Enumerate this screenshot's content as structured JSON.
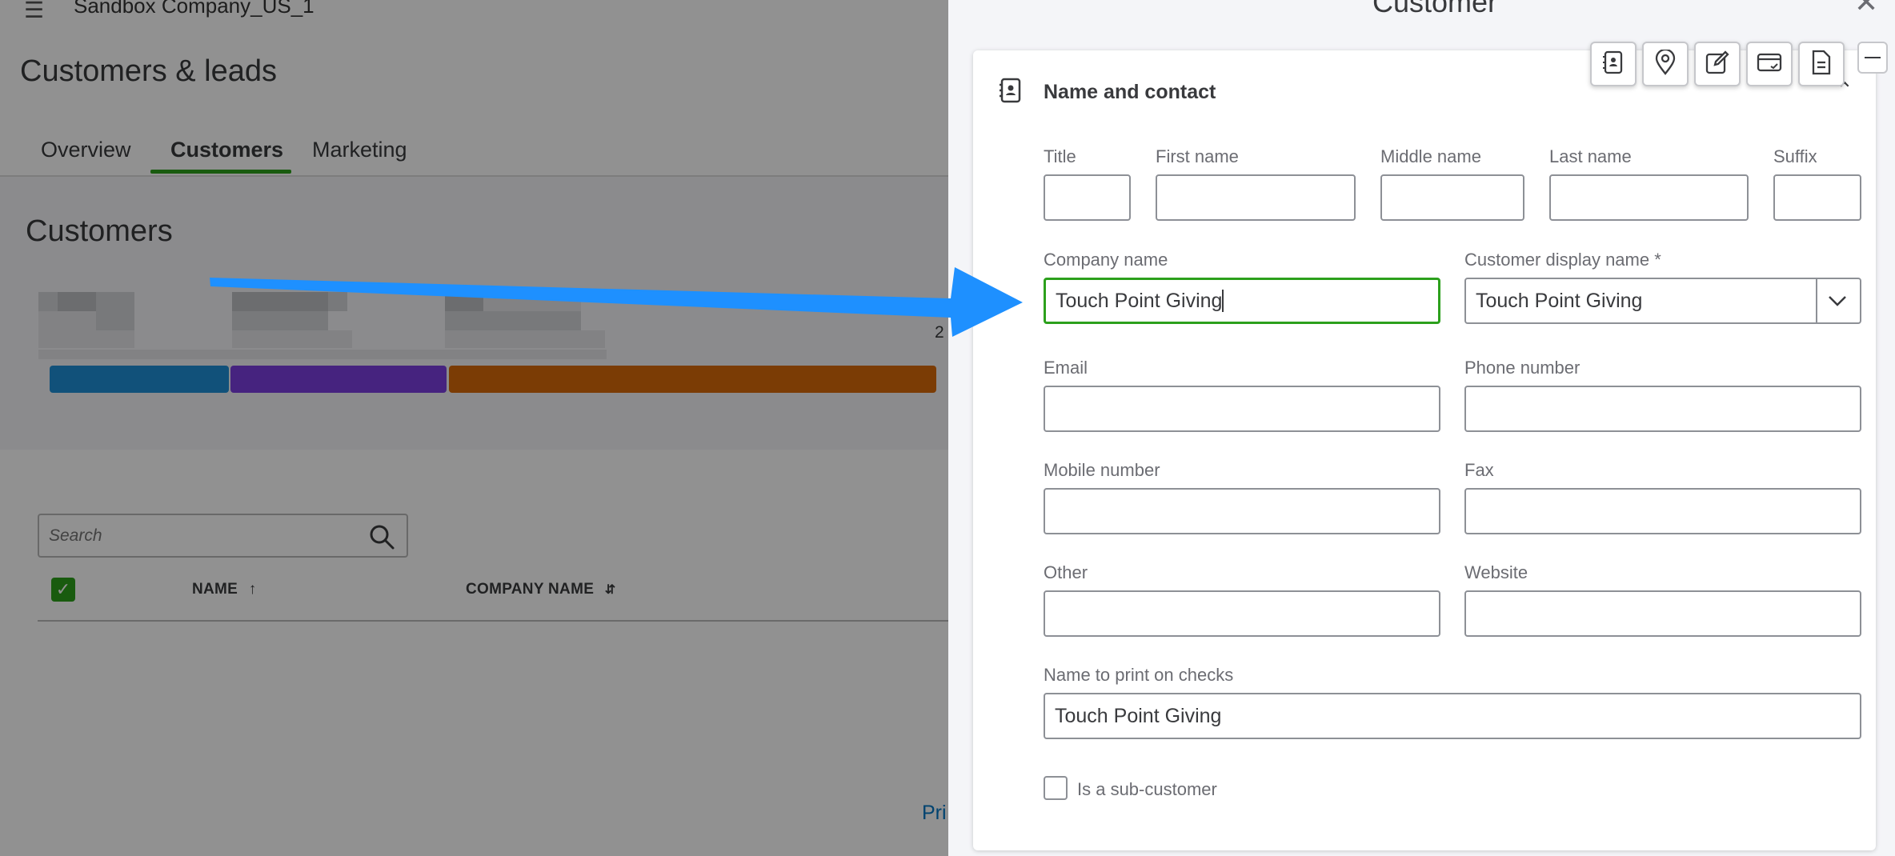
{
  "app": {
    "company_name": "Sandbox Company_US_1",
    "page_title": "Customers & leads",
    "tabs": [
      {
        "label": "Overview",
        "active": false
      },
      {
        "label": "Customers",
        "active": true
      },
      {
        "label": "Marketing",
        "active": false
      }
    ],
    "section_title": "Customers",
    "stat_fragment": "2",
    "status_bar_colors": [
      "#1f8fd6",
      "#7b3fe0",
      "#d96a0a"
    ],
    "search": {
      "placeholder": "Search",
      "value": ""
    },
    "table": {
      "columns": [
        {
          "label": "NAME",
          "sort": "ascending"
        },
        {
          "label": "COMPANY NAME",
          "sort": "sortable"
        }
      ]
    },
    "footer_link": "Pri"
  },
  "drawer": {
    "title": "Customer",
    "toolbar_icons": [
      "contact-card-icon",
      "location-pin-icon",
      "edit-note-icon",
      "payment-card-icon",
      "document-icon",
      "minimize-icon"
    ],
    "section": {
      "title": "Name and contact",
      "fields": {
        "title": {
          "label": "Title",
          "value": ""
        },
        "first_name": {
          "label": "First name",
          "value": ""
        },
        "middle_name": {
          "label": "Middle name",
          "value": ""
        },
        "last_name": {
          "label": "Last name",
          "value": ""
        },
        "suffix": {
          "label": "Suffix",
          "value": ""
        },
        "company_name": {
          "label": "Company name",
          "value": "Touch Point Giving"
        },
        "display_name": {
          "label": "Customer display name *",
          "value": "Touch Point Giving"
        },
        "email": {
          "label": "Email",
          "value": ""
        },
        "phone": {
          "label": "Phone number",
          "value": ""
        },
        "mobile": {
          "label": "Mobile number",
          "value": ""
        },
        "fax": {
          "label": "Fax",
          "value": ""
        },
        "other": {
          "label": "Other",
          "value": ""
        },
        "website": {
          "label": "Website",
          "value": ""
        },
        "print_on_checks": {
          "label": "Name to print on checks",
          "value": "Touch Point Giving"
        }
      },
      "sub_customer": {
        "label": "Is a sub-customer",
        "checked": false
      }
    }
  },
  "colors": {
    "accent_green": "#2ca01c",
    "annotation_arrow": "#1e90ff",
    "link_blue": "#0077c5"
  }
}
